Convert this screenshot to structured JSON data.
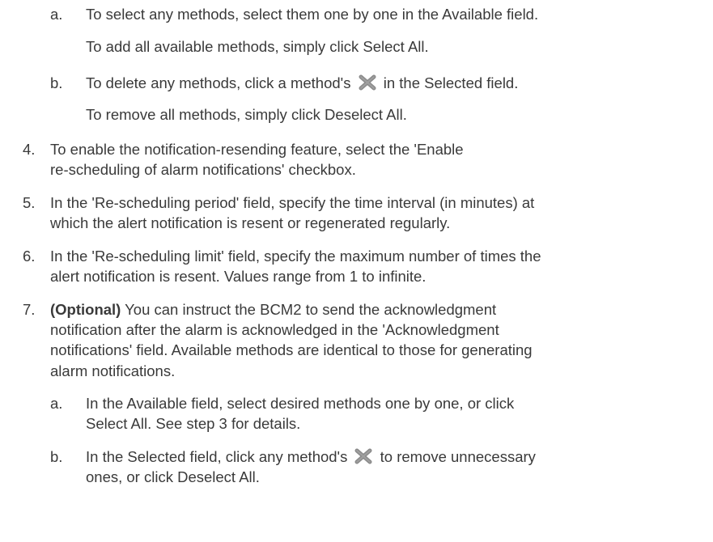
{
  "step3": {
    "a": {
      "marker": "a.",
      "line1": "To select any methods, select them one by one in the Available field.",
      "line2": "To add all available methods, simply click Select All."
    },
    "b": {
      "marker": "b.",
      "line1_before": "To delete any methods, click a method's",
      "line1_after": "in the Selected field.",
      "line2": "To remove all methods, simply click Deselect All."
    }
  },
  "step4": {
    "marker": "4.",
    "line1": "To enable the notification-resending feature, select the 'Enable",
    "line2": "re-scheduling of alarm notifications' checkbox."
  },
  "step5": {
    "marker": "5.",
    "line1": "In the 'Re-scheduling period' field, specify the time interval (in minutes) at",
    "line2": "which the alert notification is resent or regenerated regularly."
  },
  "step6": {
    "marker": "6.",
    "line1": "In the 'Re-scheduling limit' field, specify the maximum number of times the",
    "line2": "alert notification is resent. Values range from 1 to infinite."
  },
  "step7": {
    "marker": "7.",
    "optional": "(Optional)",
    "line1_rest": " You can instruct the BCM2 to send the acknowledgment",
    "line2": "notification after the alarm is acknowledged in the 'Acknowledgment",
    "line3": "notifications' field. Available methods are identical to those for generating",
    "line4": "alarm notifications.",
    "a": {
      "marker": "a.",
      "line1": "In the Available field, select desired methods one by one, or click",
      "line2": "Select All. See step 3 for details."
    },
    "b": {
      "marker": "b.",
      "line1_before": "In the Selected field, click any method's",
      "line1_after": "to remove unnecessary",
      "line2": "ones, or click Deselect All."
    }
  },
  "icons": {
    "delete": "close-x-icon"
  },
  "colors": {
    "text": "#3a3a3a",
    "icon": "#8a8a8a"
  }
}
